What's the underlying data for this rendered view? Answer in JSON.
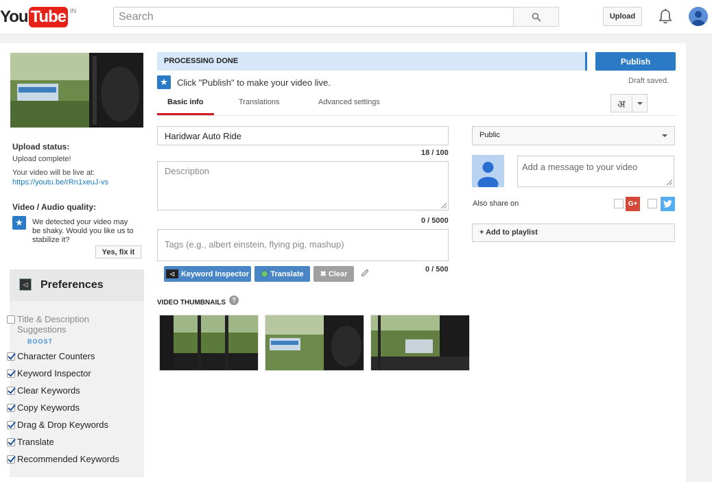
{
  "header": {
    "logo_you": "You",
    "logo_tube": "Tube",
    "logo_region": "IN",
    "search_placeholder": "Search",
    "upload_label": "Upload"
  },
  "left": {
    "upload_status_title": "Upload status:",
    "upload_complete": "Upload complete!",
    "live_at_label": "Your video will be live at:",
    "video_url": "https://youtu.be/rRn1xeuJ-vs",
    "quality_title": "Video / Audio quality:",
    "shaky_message": "We detected your video may be shaky. Would you like us to stabilize it?",
    "fix_button": "Yes, fix it"
  },
  "preferences": {
    "title": "Preferences",
    "items": [
      {
        "label": "Title & Description Suggestions",
        "checked": false,
        "disabled": true
      },
      {
        "label": "Character Counters",
        "checked": true
      },
      {
        "label": "Keyword Inspector",
        "checked": true
      },
      {
        "label": "Clear Keywords",
        "checked": true
      },
      {
        "label": "Copy Keywords",
        "checked": true
      },
      {
        "label": "Drag & Drop Keywords",
        "checked": true
      },
      {
        "label": "Translate",
        "checked": true
      },
      {
        "label": "Recommended Keywords",
        "checked": true
      }
    ],
    "boost_label": "BOOST"
  },
  "status": {
    "processing": "PROCESSING DONE",
    "publish_button": "Publish",
    "click_publish": "Click \"Publish\" to make your video live.",
    "draft_saved": "Draft saved."
  },
  "tabs": [
    {
      "label": "Basic info",
      "active": true
    },
    {
      "label": "Translations",
      "active": false
    },
    {
      "label": "Advanced settings",
      "active": false
    }
  ],
  "language_glyph": "अ",
  "form": {
    "title_value": "Haridwar Auto Ride",
    "title_counter": "18 / 100",
    "description_placeholder": "Description",
    "description_counter": "0 / 5000",
    "tags_placeholder": "Tags (e.g., albert einstein, flying pig, mashup)",
    "tags_counter": "0 / 500"
  },
  "tools": {
    "keyword_inspector": "Keyword Inspector",
    "translate": "Translate",
    "clear": "✖ Clear"
  },
  "thumbnails_label": "VIDEO THUMBNAILS",
  "right": {
    "privacy_value": "Public",
    "message_placeholder": "Add a message to your video",
    "also_share_on": "Also share on",
    "add_to_playlist": "+ Add to playlist"
  },
  "colors": {
    "youtube_red": "#e62117",
    "publish_blue": "#2a7ac6",
    "processing_bg": "#d6e7f9",
    "tool_blue": "#4a86c5",
    "clear_gray": "#a0a0a0"
  }
}
